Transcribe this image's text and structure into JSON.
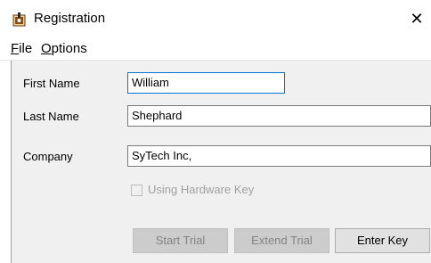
{
  "window": {
    "title": "Registration",
    "close_glyph": "✕"
  },
  "icons": {
    "app": "registration-app-icon",
    "close": "close-icon"
  },
  "menu": {
    "file": {
      "mnemonic": "F",
      "rest": "ile"
    },
    "options": {
      "mnemonic": "O",
      "rest": "ptions"
    }
  },
  "form": {
    "first_name": {
      "label": "First Name",
      "value": "William"
    },
    "last_name": {
      "label": "Last Name",
      "value": "Shephard"
    },
    "company": {
      "label": "Company",
      "value": "SyTech Inc,"
    },
    "hardware_key": {
      "label": "Using Hardware Key",
      "checked": false,
      "enabled": false
    }
  },
  "buttons": {
    "start_trial": {
      "label": "Start Trial",
      "enabled": false
    },
    "extend_trial": {
      "label": "Extend Trial",
      "enabled": false
    },
    "enter_key": {
      "label": "Enter Key",
      "enabled": true
    }
  },
  "colors": {
    "focus_border": "#0078d7",
    "dialog_bg": "#f0f0f0",
    "disabled_text": "#838383"
  }
}
